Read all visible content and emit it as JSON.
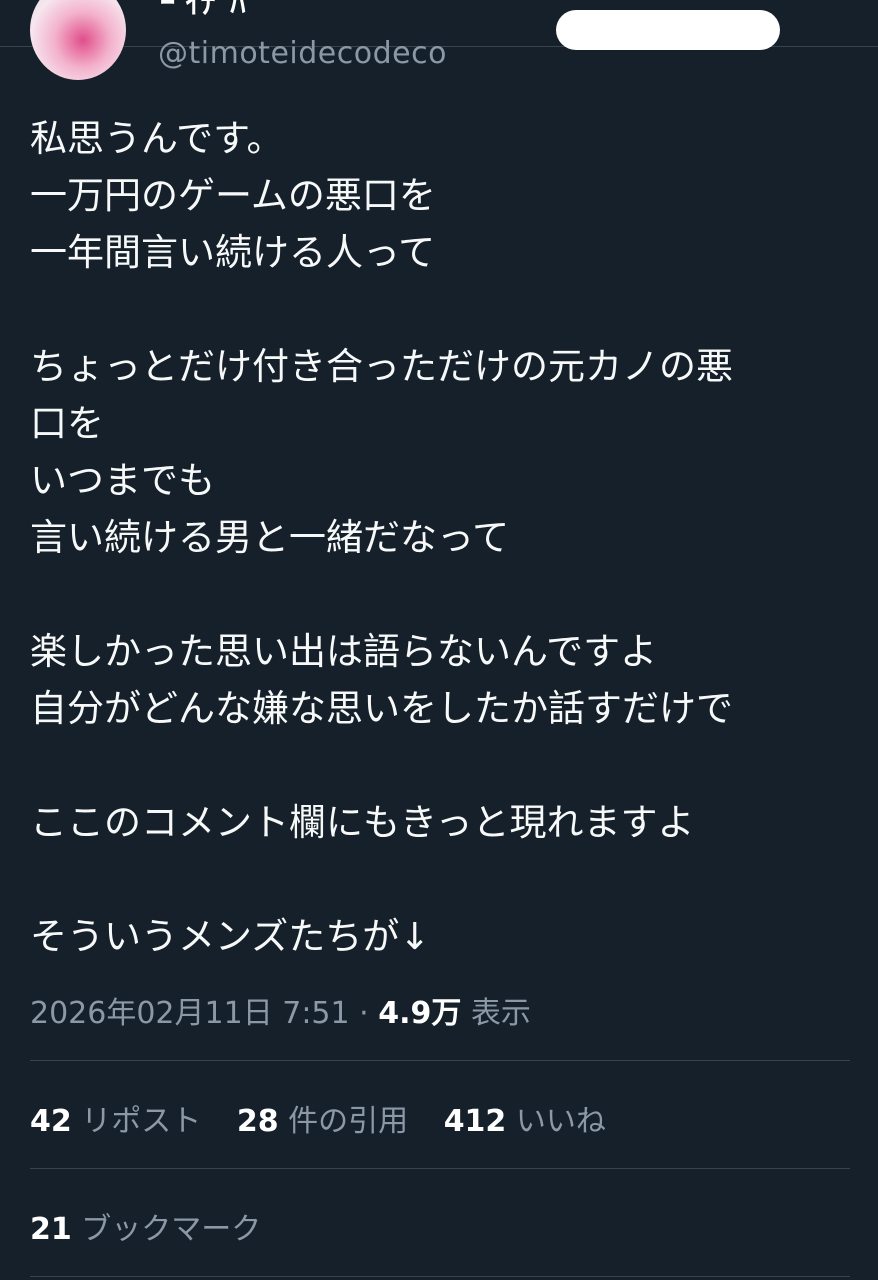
{
  "header": {
    "display_name_partial": "ｰ ｲﾃﾞﾊ",
    "handle": "@timoteidecodeco"
  },
  "tweet": {
    "lines": [
      "私思うんです。",
      "一万円のゲームの悪口を",
      "一年間言い続ける人って",
      "",
      "ちょっとだけ付き合っただけの元カノの悪",
      "口を",
      "いつまでも",
      "言い続ける男と一緒だなって",
      "",
      "楽しかった思い出は語らないんですよ",
      "自分がどんな嫌な思いをしたか話すだけで",
      "",
      "ここのコメント欄にもきっと現れますよ",
      "",
      "そういうメンズたちが↓"
    ],
    "timestamp": "2026年02月11日 7:51",
    "separator": " · ",
    "views_count": "4.9万",
    "views_label": " 表示"
  },
  "stats": {
    "reposts_count": "42",
    "reposts_label": "リポスト",
    "quotes_count": "28",
    "quotes_label": "件の引用",
    "likes_count": "412",
    "likes_label": "いいね",
    "bookmarks_count": "21",
    "bookmarks_label": "ブックマーク"
  }
}
